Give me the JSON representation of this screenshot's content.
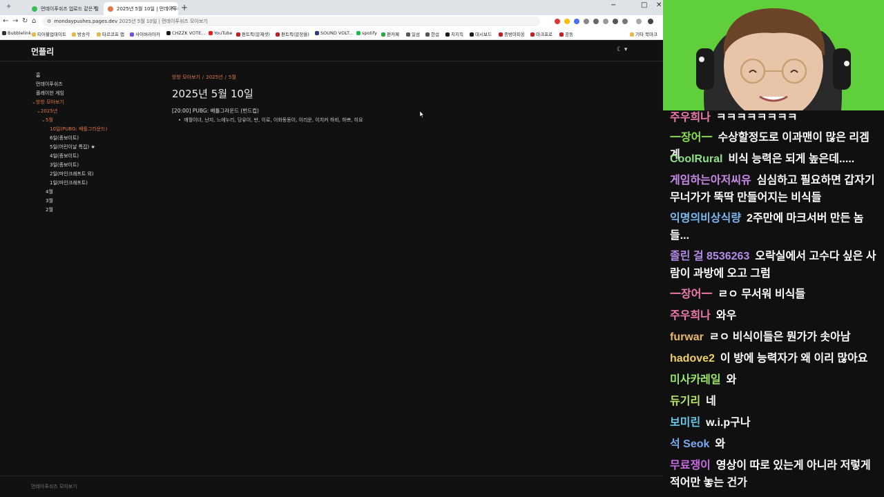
{
  "browser": {
    "tabs": [
      {
        "label": "먼데이푸쉬즈 업로드 같은 걸"
      },
      {
        "label": "2025년 5월 10일 | 먼데이푸쉬즈"
      }
    ],
    "new_tab": "+",
    "window_controls": {
      "minimize": "−",
      "maximize": "□",
      "close": "✕"
    },
    "address": {
      "host": "mondaypushes.pages.dev",
      "page": "2025년 5월 10일 | 먼데이푸쉬즈 모아보기"
    },
    "bookmarks": [
      "Bubblelink",
      "티어불업데이트",
      "방송각",
      "타르코프 맵",
      "사이버러아카",
      "CHZZK VOTE...",
      "YouTube",
      "편트픽(문제셋)",
      "편트픽(문장을)",
      "SOUND VOLT...",
      "spotify",
      "편카페",
      "일섬",
      "한섭",
      "치지직",
      "대시보드",
      "종방마피웅",
      "마크프로",
      "공동",
      "기타 북마크"
    ]
  },
  "site": {
    "title": "먼플리",
    "theme_toggle": "☾ ▾",
    "sidebar": {
      "home": "홈",
      "mondaypushes": "먼데이푸쉬즈",
      "played_games": "플레이한 게임",
      "archive": "방방 모아보기",
      "y2025": "2025년",
      "may": "5월",
      "may_items": [
        "10일(PUBG: 배틀그라운드)",
        "6일(종보이트)",
        "5일(어린이날 특집) ★",
        "4일(종보이트)",
        "3일(종보이트)",
        "2일(마인크래프트 외)",
        "1일(마인크래프트)"
      ],
      "apr": "4월",
      "mar": "3월",
      "feb": "2월"
    },
    "breadcrumb": {
      "a": "방방 모아보기",
      "b": "2025년",
      "c": "5월",
      "sep": "/"
    },
    "page_title": "2025년 5월 10일",
    "entry": {
      "title": "[20:00] PUBG: 배틀그라운드 (번드컵)",
      "participants": "깨월이녀, 난지, 느에누리, 당유이, 반, 이로, 이화동동이, 이리운, 이치커 하비, 하쁘, 히요"
    },
    "footer": "먼데이푸쉬즈 모아보기"
  },
  "chat": [
    {
      "nick": "주우희나",
      "msg": "ㅋㅋㅋㅋㅋㅋㅋㅋ",
      "color": "#f07ab0"
    },
    {
      "nick": "一장어一",
      "msg": "수상할정도로 이과맨이 많은 리겜계",
      "color": "#8be04e"
    },
    {
      "nick": "CoolRural",
      "msg": "비식 능력은 되게 높은데.....",
      "color": "#8fe08a"
    },
    {
      "nick": "게임하는아저씨유",
      "msg": "심심하고 필요하면 갑자기 무너가가 뚝딱 만들어지는 비식들",
      "color": "#c98be8"
    },
    {
      "nick": "익명의비상식량",
      "msg": "2주만에 마크서버 만든 놈들...",
      "color": "#7ab8f0"
    },
    {
      "nick": "졸린 걸 8536263",
      "msg": "오락실에서 고수다 싶은 사람이 과방에 오고 그럼",
      "color": "#b58be8"
    },
    {
      "nick": "一장어一",
      "msg": "ㄹㅇ 무서워 비식들",
      "color": "#f07ab0"
    },
    {
      "nick": "주우희나",
      "msg": "와우",
      "color": "#f07ab0"
    },
    {
      "nick": "furwar",
      "msg": "ㄹㅇ 비식이들은 뭔가가 솟아남",
      "color": "#e8b86a"
    },
    {
      "nick": "hadove2",
      "msg": "이 방에 능력자가 왜 이리 많아요",
      "color": "#f0d060"
    },
    {
      "nick": "미사카레일",
      "msg": "와",
      "color": "#9be86a"
    },
    {
      "nick": "듀기리",
      "msg": "네",
      "color": "#b8e86a"
    },
    {
      "nick": "보미린",
      "msg": "w.i.p구나",
      "color": "#6ac8e8"
    },
    {
      "nick": "석 Seok",
      "msg": "와",
      "color": "#7aa8f0"
    },
    {
      "nick": "무료쟁이",
      "msg": "영상이 따로 있는게 아니라 저렇게 적어만 놓는 건가",
      "color": "#c86ae8"
    }
  ]
}
